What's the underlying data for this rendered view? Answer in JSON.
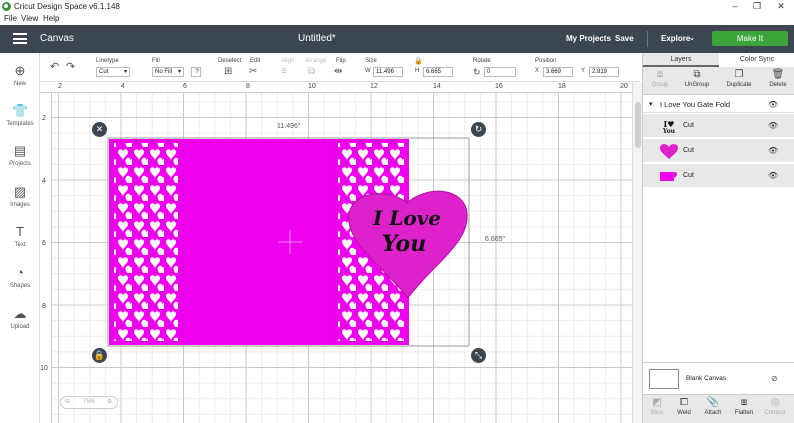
{
  "window": {
    "title": "Cricut Design Space  v6.1.148",
    "minimize": "–",
    "maximize": "❐",
    "close": "✕"
  },
  "menu": [
    "File",
    "View",
    "Help"
  ],
  "header": {
    "section": "Canvas",
    "document": "Untitled*",
    "my_projects": "My Projects",
    "save": "Save",
    "explore": "Explore",
    "make_it": "Make It",
    "make_it_color": "#3ba53b"
  },
  "left_tools": [
    {
      "label": "New",
      "icon": "plus-circle-icon"
    },
    {
      "label": "Templates",
      "icon": "shirt-icon"
    },
    {
      "label": "Projects",
      "icon": "projects-icon"
    },
    {
      "label": "Images",
      "icon": "image-icon"
    },
    {
      "label": "Text",
      "icon": "text-icon"
    },
    {
      "label": "Shapes",
      "icon": "shapes-icon"
    },
    {
      "label": "Upload",
      "icon": "cloud-upload-icon"
    }
  ],
  "toolbar": {
    "linetype_label": "Linetype",
    "linetype_value": "Cut",
    "fill_label": "Fill",
    "fill_value": "No Fill",
    "deselect_label": "Deselect",
    "edit_label": "Edit",
    "align_label": "Align",
    "arrange_label": "Arrange",
    "flip_label": "Flip",
    "size_label": "Size",
    "w_label": "W",
    "width": "11.496",
    "h_label": "H",
    "height": "6.665",
    "rotate_label": "Rotate",
    "rotate_value": "0",
    "position_label": "Position",
    "x_label": "X",
    "x_value": "3.669",
    "y_label": "Y",
    "y_value": "2.819"
  },
  "rulers": {
    "top": [
      "2",
      "4",
      "6",
      "8",
      "10",
      "12",
      "14",
      "16",
      "18",
      "20"
    ],
    "left": [
      "2",
      "4",
      "6",
      "8",
      "10"
    ]
  },
  "canvas": {
    "width_label": "11.496\"",
    "height_label": "6.665\"",
    "card_color": "#ee00ee",
    "heart_color": "#dd22cc",
    "heart_text_line1": "I Love",
    "heart_text_line2": "You",
    "zoom": "75%"
  },
  "right_panel": {
    "tabs": [
      "Layers",
      "Color Sync"
    ],
    "actions": [
      "Group",
      "UnGroup",
      "Duplicate",
      "Delete"
    ],
    "group_name": "I Love You Gate Fold",
    "layers": [
      {
        "label": "Cut",
        "thumb": "love-text-thumb",
        "color": "#111111"
      },
      {
        "label": "Cut",
        "thumb": "heart-thumb",
        "color": "#dd22cc"
      },
      {
        "label": "Cut",
        "thumb": "card-thumb",
        "color": "#ee00ee"
      }
    ],
    "blank_canvas": "Blank Canvas",
    "bottom_tools": [
      "Slice",
      "Weld",
      "Attach",
      "Flatten",
      "Contour"
    ]
  }
}
